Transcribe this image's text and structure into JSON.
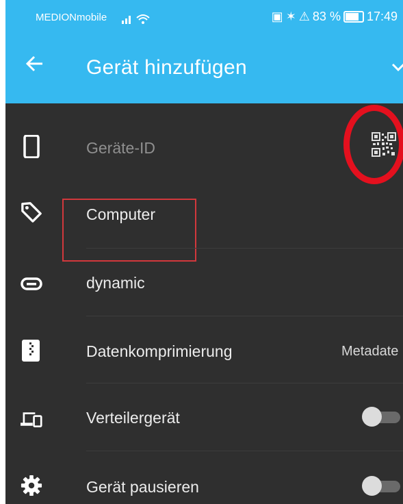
{
  "status_bar": {
    "carrier": "MEDIONmobile",
    "battery": "83 %",
    "time": "17:49"
  },
  "app_bar": {
    "title": "Gerät hinzufügen"
  },
  "form": {
    "device_id": {
      "placeholder": "Geräte-ID"
    },
    "name": {
      "value": "Computer"
    },
    "address": {
      "value": "dynamic"
    },
    "compression": {
      "label": "Datenkomprimierung",
      "value": "Metadate"
    },
    "introducer": {
      "label": "Verteilergerät",
      "on": false
    },
    "paused": {
      "label": "Gerät pausieren",
      "on": false
    }
  },
  "colors": {
    "accent": "#36b9f0",
    "background": "#2f2f2f",
    "annotation_red": "#e4101e"
  },
  "icons": [
    "arrow-back-icon",
    "chevron-down-icon",
    "phone-icon",
    "qr-code-icon",
    "tag-icon",
    "link-icon",
    "archive-icon",
    "devices-icon",
    "gear-icon"
  ]
}
